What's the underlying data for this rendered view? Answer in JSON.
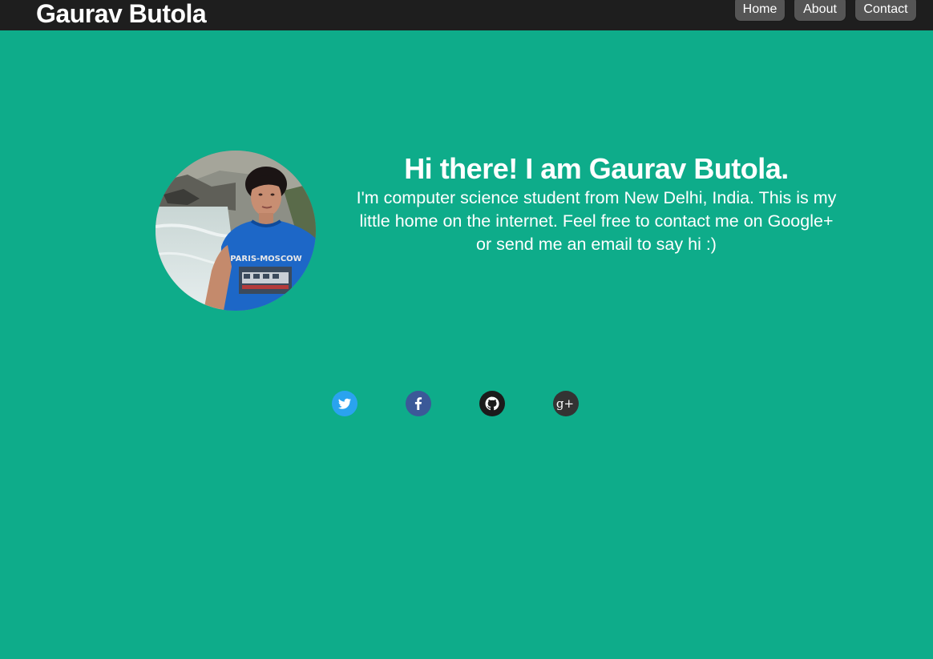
{
  "navbar": {
    "brand": "Gaurav Butola",
    "links": [
      {
        "label": "Home"
      },
      {
        "label": "About"
      },
      {
        "label": "Contact"
      }
    ]
  },
  "hero": {
    "headline": "Hi there! I am Gaurav Butola.",
    "intro": "I'm computer science student from New Delhi, India. This is my little home on the internet. Feel free to contact me on Google+ or send me an email to say hi :)",
    "avatar_shirt_text": "PARIS-MOSCOW"
  },
  "social": [
    {
      "icon": "twitter-icon",
      "color": "#2aa3ef"
    },
    {
      "icon": "facebook-icon",
      "color": "#3b5998"
    },
    {
      "icon": "github-icon",
      "color": "#1b1b1b"
    },
    {
      "icon": "google-plus-icon",
      "color": "#333333",
      "glyph": "g+"
    }
  ],
  "colors": {
    "background": "#0eac8a",
    "navbar": "#1e1e1e",
    "nav_button": "#555555"
  }
}
